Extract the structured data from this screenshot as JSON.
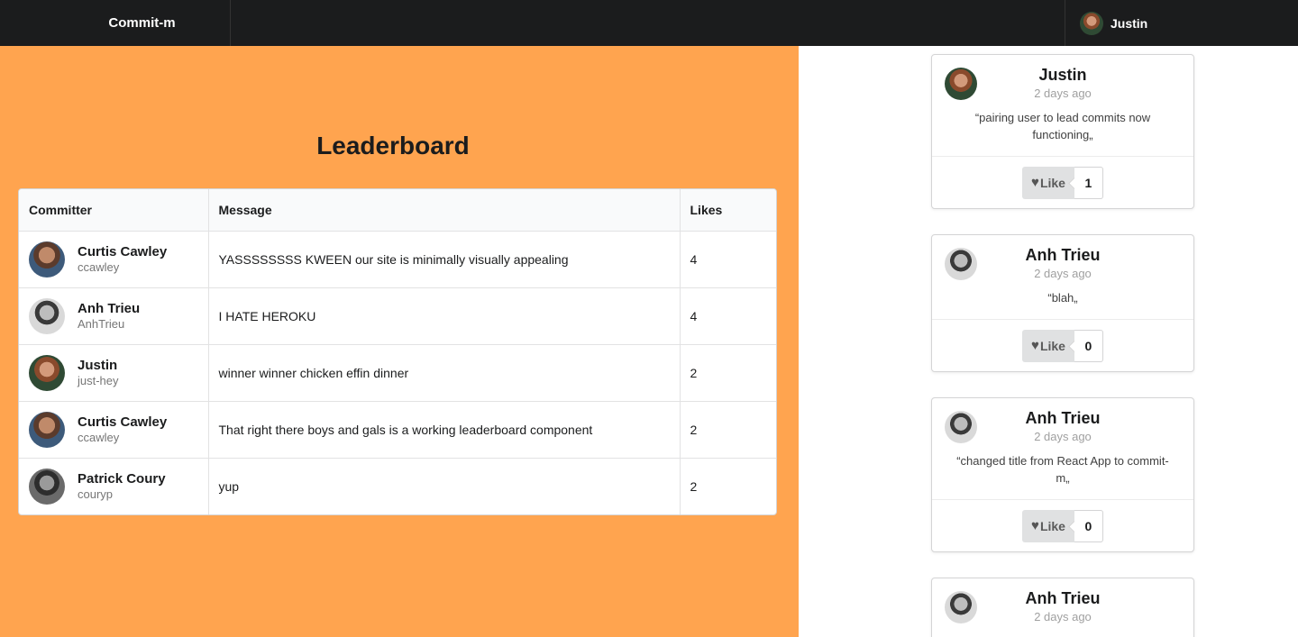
{
  "nav": {
    "brand": "Commit-m",
    "user_name": "Justin"
  },
  "leaderboard": {
    "title": "Leaderboard",
    "columns": [
      "Committer",
      "Message",
      "Likes"
    ],
    "rows": [
      {
        "name": "Curtis Cawley",
        "handle": "ccawley",
        "message": "YASSSSSSSS KWEEN our site is minimally visually appealing",
        "likes": "4",
        "avatar": "curtis-avatar"
      },
      {
        "name": "Anh Trieu",
        "handle": "AnhTrieu",
        "message": "I HATE HEROKU",
        "likes": "4",
        "avatar": "anh-avatar"
      },
      {
        "name": "Justin",
        "handle": "just-hey",
        "message": "winner winner chicken effin dinner",
        "likes": "2",
        "avatar": "justin-avatar"
      },
      {
        "name": "Curtis Cawley",
        "handle": "ccawley",
        "message": "That right there boys and gals is a working leaderboard component",
        "likes": "2",
        "avatar": "curtis-avatar"
      },
      {
        "name": "Patrick Coury",
        "handle": "couryp",
        "message": "yup",
        "likes": "2",
        "avatar": "patrick-avatar"
      }
    ]
  },
  "feed": {
    "like_label": "Like",
    "cards": [
      {
        "name": "Justin",
        "time": "2 days ago",
        "message": "“pairing user to lead commits now functioning„",
        "likes": "1",
        "avatar": "justin-avatar"
      },
      {
        "name": "Anh Trieu",
        "time": "2 days ago",
        "message": "“blah„",
        "likes": "0",
        "avatar": "anh-avatar"
      },
      {
        "name": "Anh Trieu",
        "time": "2 days ago",
        "message": "“changed title from React App to commit-m„",
        "likes": "0",
        "avatar": "anh-avatar"
      },
      {
        "name": "Anh Trieu",
        "time": "2 days ago",
        "message": "",
        "likes": "",
        "avatar": "anh-avatar"
      }
    ]
  },
  "colors": {
    "topbar": "#1b1c1d",
    "left_panel": "#ffa44f"
  }
}
